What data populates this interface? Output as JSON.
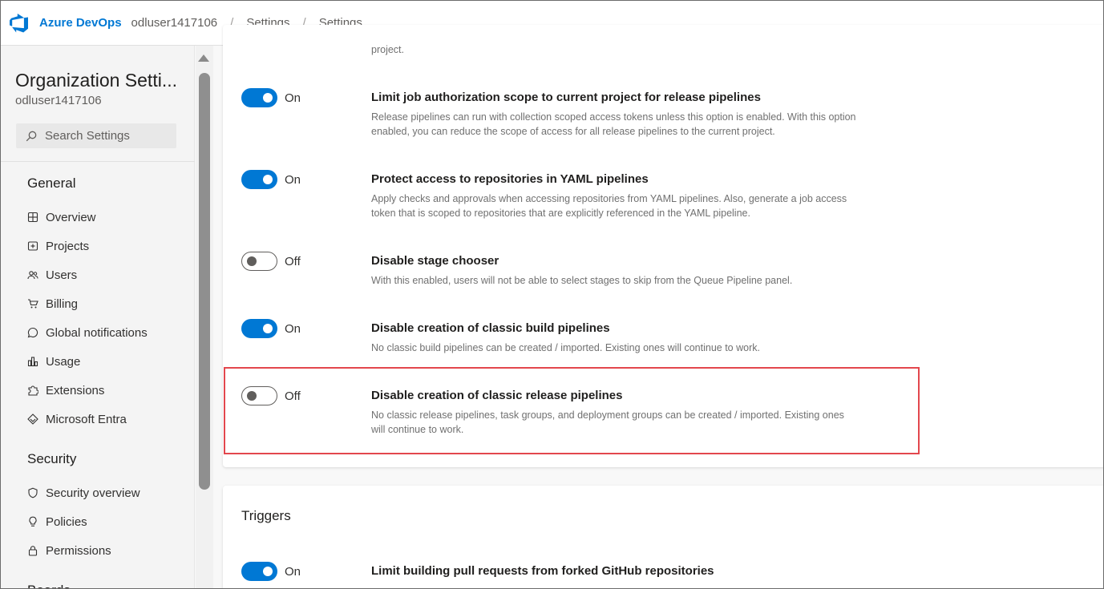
{
  "header": {
    "brand": "Azure DevOps",
    "breadcrumbs": [
      "odluser1417106",
      "Settings",
      "Settings"
    ]
  },
  "sidebar": {
    "title": "Organization Setti...",
    "subtitle": "odluser1417106",
    "search_placeholder": "Search Settings",
    "groups": [
      {
        "title": "General",
        "items": [
          {
            "label": "Overview",
            "icon": "overview-icon"
          },
          {
            "label": "Projects",
            "icon": "projects-icon"
          },
          {
            "label": "Users",
            "icon": "users-icon"
          },
          {
            "label": "Billing",
            "icon": "cart-icon"
          },
          {
            "label": "Global notifications",
            "icon": "chat-icon"
          },
          {
            "label": "Usage",
            "icon": "usage-icon"
          },
          {
            "label": "Extensions",
            "icon": "puzzle-icon"
          },
          {
            "label": "Microsoft Entra",
            "icon": "entra-icon"
          }
        ]
      },
      {
        "title": "Security",
        "items": [
          {
            "label": "Security overview",
            "icon": "shield-icon"
          },
          {
            "label": "Policies",
            "icon": "bulb-icon"
          },
          {
            "label": "Permissions",
            "icon": "lock-icon"
          }
        ]
      },
      {
        "title": "Boards",
        "items": []
      }
    ]
  },
  "settings": {
    "top_cut_desc": "project.",
    "items": [
      {
        "state": "On",
        "title": "Limit job authorization scope to current project for release pipelines",
        "desc": "Release pipelines can run with collection scoped access tokens unless this option is enabled. With this option enabled, you can reduce the scope of access for all release pipelines to the current project."
      },
      {
        "state": "On",
        "title": "Protect access to repositories in YAML pipelines",
        "desc": "Apply checks and approvals when accessing repositories from YAML pipelines. Also, generate a job access token that is scoped to repositories that are explicitly referenced in the YAML pipeline."
      },
      {
        "state": "Off",
        "title": "Disable stage chooser",
        "desc": "With this enabled, users will not be able to select stages to skip from the Queue Pipeline panel."
      },
      {
        "state": "On",
        "title": "Disable creation of classic build pipelines",
        "desc": "No classic build pipelines can be created / imported. Existing ones will continue to work."
      },
      {
        "state": "Off",
        "title": "Disable creation of classic release pipelines",
        "desc": "No classic release pipelines, task groups, and deployment groups can be created / imported. Existing ones will continue to work."
      }
    ]
  },
  "triggers": {
    "section_title": "Triggers",
    "items": [
      {
        "state": "On",
        "title": "Limit building pull requests from forked GitHub repositories"
      }
    ]
  },
  "colors": {
    "accent": "#0078d4",
    "highlight_border": "#e3474d"
  }
}
